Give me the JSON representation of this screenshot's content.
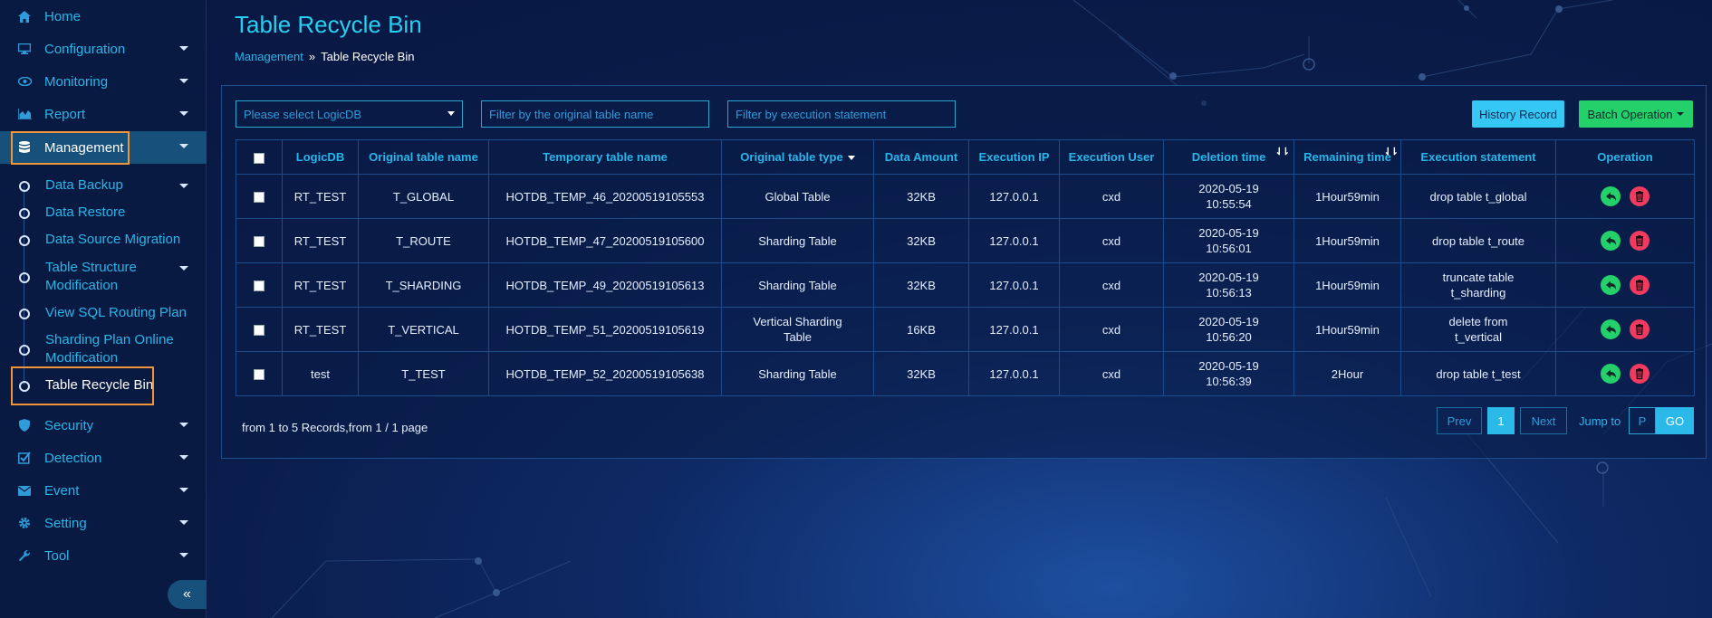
{
  "sidebar": {
    "items": [
      {
        "label": "Home",
        "icon": "home-icon"
      },
      {
        "label": "Configuration",
        "icon": "monitor-icon"
      },
      {
        "label": "Monitoring",
        "icon": "eye-icon"
      },
      {
        "label": "Report",
        "icon": "area-chart-icon"
      },
      {
        "label": "Management",
        "icon": "database-icon"
      },
      {
        "label": "Security",
        "icon": "shield-icon"
      },
      {
        "label": "Detection",
        "icon": "checkbox-icon"
      },
      {
        "label": "Event",
        "icon": "envelope-icon"
      },
      {
        "label": "Setting",
        "icon": "gear-icon"
      },
      {
        "label": "Tool",
        "icon": "wrench-icon"
      }
    ],
    "sub_items": [
      {
        "label": "Data Backup"
      },
      {
        "label": "Data Restore"
      },
      {
        "label": "Data Source Migration"
      },
      {
        "label": "Table Structure Modification"
      },
      {
        "label": "View SQL Routing Plan"
      },
      {
        "label": "Sharding Plan Online Modification"
      },
      {
        "label": "Table Recycle Bin"
      }
    ],
    "collapse_symbol": "«"
  },
  "header": {
    "title": "Table Recycle Bin",
    "breadcrumb_parent": "Management",
    "breadcrumb_sep": "»",
    "breadcrumb_current": "Table Recycle Bin"
  },
  "filters": {
    "logicdb_placeholder": "Please select LogicDB",
    "table_name_placeholder": "Filter by the original table name",
    "statement_placeholder": "Filter by execution statement"
  },
  "buttons": {
    "history": "History Record",
    "batch": "Batch Operation"
  },
  "table": {
    "columns": [
      "LogicDB",
      "Original table name",
      "Temporary table name",
      "Original table type",
      "Data Amount",
      "Execution IP",
      "Execution User",
      "Deletion time",
      "Remaining time",
      "Execution statement",
      "Operation"
    ],
    "rows": [
      [
        "RT_TEST",
        "T_GLOBAL",
        "HOTDB_TEMP_46_20200519105553",
        "Global Table",
        "32KB",
        "127.0.0.1",
        "cxd",
        "2020-05-19 10:55:54",
        "1Hour59min",
        "drop table t_global"
      ],
      [
        "RT_TEST",
        "T_ROUTE",
        "HOTDB_TEMP_47_20200519105600",
        "Sharding Table",
        "32KB",
        "127.0.0.1",
        "cxd",
        "2020-05-19 10:56:01",
        "1Hour59min",
        "drop table t_route"
      ],
      [
        "RT_TEST",
        "T_SHARDING",
        "HOTDB_TEMP_49_20200519105613",
        "Sharding Table",
        "32KB",
        "127.0.0.1",
        "cxd",
        "2020-05-19 10:56:13",
        "1Hour59min",
        "truncate table t_sharding"
      ],
      [
        "RT_TEST",
        "T_VERTICAL",
        "HOTDB_TEMP_51_20200519105619",
        "Vertical Sharding Table",
        "16KB",
        "127.0.0.1",
        "cxd",
        "2020-05-19 10:56:20",
        "1Hour59min",
        "delete from t_vertical"
      ],
      [
        "test",
        "T_TEST",
        "HOTDB_TEMP_52_20200519105638",
        "Sharding Table",
        "32KB",
        "127.0.0.1",
        "cxd",
        "2020-05-19 10:56:39",
        "2Hour",
        "drop table t_test"
      ]
    ]
  },
  "pagination": {
    "info": "from 1 to 5 Records,from 1 / 1 page",
    "prev": "Prev",
    "current": "1",
    "next": "Next",
    "jump_label": "Jump to",
    "jump_placeholder": "P",
    "go": "GO"
  },
  "colors": {
    "accent": "#27b6ea",
    "title": "#27d0f0",
    "highlight": "#f0953a",
    "history_button": "#35c8f4",
    "batch_button": "#23d06a",
    "restore": "#23d06a",
    "delete": "#ef3b5f"
  }
}
